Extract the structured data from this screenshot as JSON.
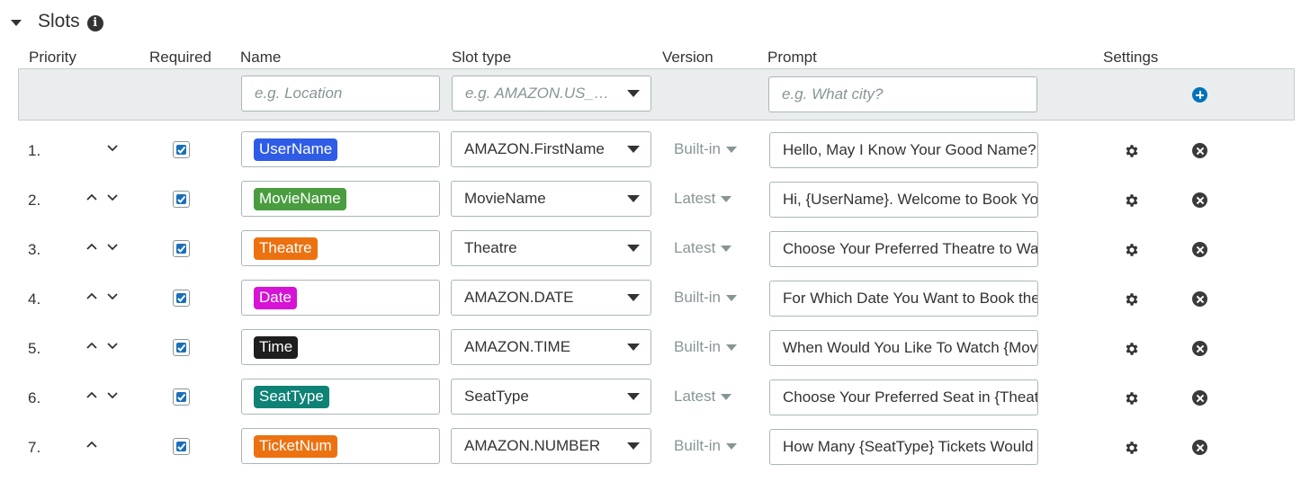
{
  "section": {
    "title": "Slots"
  },
  "columns": {
    "priority": "Priority",
    "required": "Required",
    "name": "Name",
    "slot_type": "Slot type",
    "version": "Version",
    "prompt": "Prompt",
    "settings": "Settings"
  },
  "new_slot": {
    "name_placeholder": "e.g. Location",
    "slot_type_placeholder": "e.g. AMAZON.US_CITY",
    "prompt_placeholder": "e.g. What city?"
  },
  "slots": [
    {
      "num": "1.",
      "up": false,
      "down": true,
      "required": true,
      "name": "UserName",
      "color": "#2e5ce6",
      "slot_type": "AMAZON.FirstName",
      "version": "Built-in",
      "prompt": "Hello, May I Know Your Good Name?"
    },
    {
      "num": "2.",
      "up": true,
      "down": true,
      "required": true,
      "name": "MovieName",
      "color": "#4a9d3f",
      "slot_type": "MovieName",
      "version": "Latest",
      "prompt": "Hi, {UserName}. Welcome to Book Your Movie"
    },
    {
      "num": "3.",
      "up": true,
      "down": true,
      "required": true,
      "name": "Theatre",
      "color": "#ec7211",
      "slot_type": "Theatre",
      "version": "Latest",
      "prompt": "Choose Your Preferred Theatre to Watch"
    },
    {
      "num": "4.",
      "up": true,
      "down": true,
      "required": true,
      "name": "Date",
      "color": "#d613d6",
      "slot_type": "AMAZON.DATE",
      "version": "Built-in",
      "prompt": "For Which Date You Want to Book the Tickets"
    },
    {
      "num": "5.",
      "up": true,
      "down": true,
      "required": true,
      "name": "Time",
      "color": "#1e1e1e",
      "slot_type": "AMAZON.TIME",
      "version": "Built-in",
      "prompt": "When Would You Like To Watch {MovieName}"
    },
    {
      "num": "6.",
      "up": true,
      "down": true,
      "required": true,
      "name": "SeatType",
      "color": "#0e8275",
      "slot_type": "SeatType",
      "version": "Latest",
      "prompt": "Choose Your Preferred Seat in {Theatre}"
    },
    {
      "num": "7.",
      "up": true,
      "down": false,
      "required": true,
      "name": "TicketNum",
      "color": "#ec7211",
      "slot_type": "AMAZON.NUMBER",
      "version": "Built-in",
      "prompt": "How Many {SeatType} Tickets Would You Like"
    }
  ]
}
